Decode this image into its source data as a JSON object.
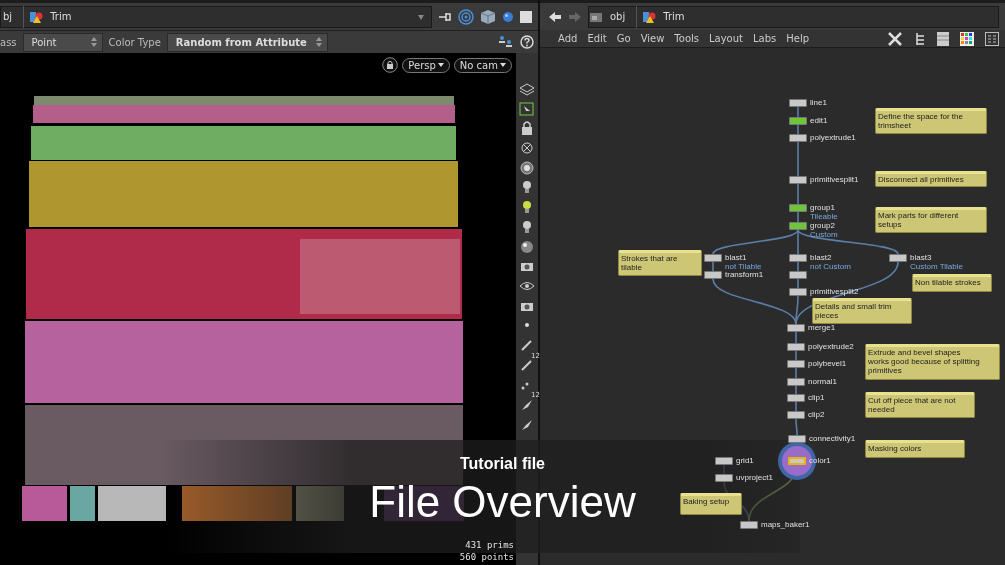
{
  "left_pane": {
    "path": [
      "bj",
      "Trim"
    ],
    "parameters": [
      {
        "label": "ass",
        "value": "Point"
      },
      {
        "label": "Color Type",
        "value": "Random from Attribute"
      }
    ],
    "viewport": {
      "camera_view": "Persp",
      "camera": "No cam",
      "stats": [
        "431  prims",
        "560 points"
      ]
    },
    "tools": [
      {
        "kind": "layers"
      },
      {
        "kind": "cursor"
      },
      {
        "kind": "lock"
      },
      {
        "kind": "crossed"
      },
      {
        "kind": "ring"
      },
      {
        "kind": "bulb"
      },
      {
        "kind": "litbulb"
      },
      {
        "kind": "bulb"
      },
      {
        "kind": "sphere"
      },
      {
        "kind": "camera"
      },
      {
        "kind": "eye"
      },
      {
        "kind": "camera"
      },
      {
        "kind": "dot"
      },
      {
        "kind": "pen"
      },
      {
        "kind": "pen",
        "label": "12"
      },
      {
        "kind": "dots"
      },
      {
        "kind": "brush",
        "label": "12"
      },
      {
        "kind": "brush"
      }
    ]
  },
  "right_pane": {
    "path": [
      "obj",
      "Trim"
    ],
    "menu": [
      "Add",
      "Edit",
      "Go",
      "View",
      "Tools",
      "Layout",
      "Labs",
      "Help"
    ],
    "nodes": [
      {
        "name": "line1",
        "color": "#c8c8c8",
        "selected": false
      },
      {
        "name": "edit1",
        "color": "#6ec53a",
        "selected": false
      },
      {
        "name": "polyextrude1",
        "color": "#c8c8c8",
        "selected": false
      },
      {
        "name": "primitivesplit1",
        "color": "#c8c8c8",
        "selected": false
      },
      {
        "name": "group1",
        "tag": "Tileable",
        "color": "#6ec53a",
        "selected": false
      },
      {
        "name": "group2",
        "tag": "Custom",
        "color": "#6ec53a",
        "selected": false
      },
      {
        "name": "blast1",
        "tag": "not Tilable",
        "color": "#c8c8c8",
        "selected": false
      },
      {
        "name": "transform1",
        "color": "#c8c8c8",
        "selected": false
      },
      {
        "name": "blast2",
        "tag": "not Custom",
        "color": "#c8c8c8",
        "selected": false
      },
      {
        "color": "#c8c8c8",
        "selected": false
      },
      {
        "name": "primitivesplit2",
        "color": "#c8c8c8",
        "selected": false
      },
      {
        "name": "blast3",
        "tag": "Custom Tilable",
        "color": "#c8c8c8",
        "selected": false
      },
      {
        "name": "merge1",
        "color": "#c8c8c8",
        "selected": false
      },
      {
        "name": "polyextrude2",
        "color": "#c8c8c8",
        "selected": false
      },
      {
        "name": "polybevel1",
        "color": "#c8c8c8",
        "selected": false
      },
      {
        "name": "normal1",
        "color": "#c8c8c8",
        "selected": false
      },
      {
        "name": "clip1",
        "color": "#c8c8c8",
        "selected": false
      },
      {
        "name": "clip2",
        "color": "#c8c8c8",
        "selected": false
      },
      {
        "name": "connectivity1",
        "color": "#c8c8c8",
        "selected": false
      },
      {
        "name": "color1",
        "color": "#c8c8c8",
        "selected": true
      },
      {
        "name": "grid1",
        "color": "#c8c8c8",
        "selected": false
      },
      {
        "name": "uvproject1",
        "color": "#c8c8c8",
        "selected": false
      },
      {
        "name": "maps_baker1",
        "color": "#c8c8c8",
        "selected": false
      }
    ],
    "notes": [
      "Define the space for the trimsheet",
      "Disconnect all primitives",
      "Mark parts for different setups",
      "Strokes that are tilable",
      "Details and small trim pieces",
      "Non tilable strokes",
      "Extrude and bevel shapes\nworks good because of splitting primitives",
      "Cut off piece that are not needed",
      "Masking colors",
      "Baking setup"
    ]
  },
  "title_card": {
    "subtitle": "Tutorial file",
    "title": "File Overview"
  }
}
